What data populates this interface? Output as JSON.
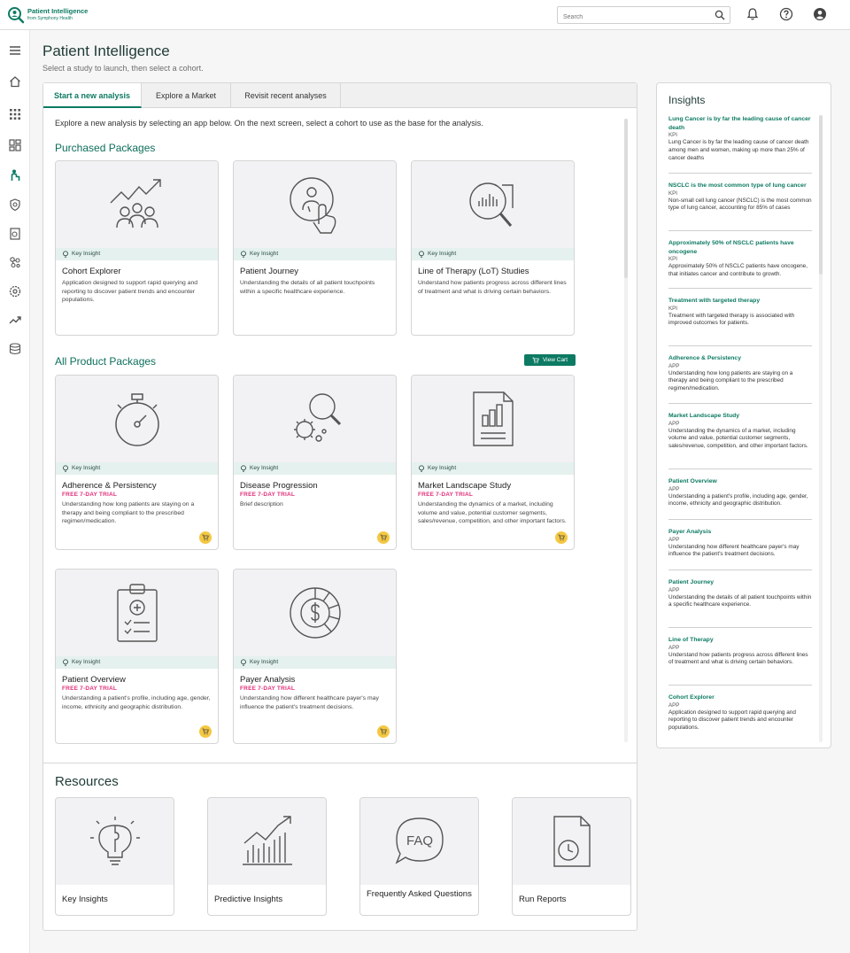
{
  "app": {
    "title": "Patient Intelligence",
    "subtitle": "from Symphony Health",
    "search_placeholder": "Search",
    "accent": "#0d7a63"
  },
  "page": {
    "title": "Patient Intelligence",
    "subtitle": "Select a study to launch, then select a cohort."
  },
  "tabs": [
    {
      "label": "Start a new analysis",
      "active": true
    },
    {
      "label": "Explore a Market",
      "active": false
    },
    {
      "label": "Revisit recent analyses",
      "active": false
    }
  ],
  "intro": "Explore a new analysis by selecting an app below. On the next screen, select a cohort to use as the base for the analysis.",
  "purchased": {
    "heading": "Purchased Packages",
    "cards": [
      {
        "title": "Cohort Explorer",
        "key_insight": "Key Insight",
        "desc": "Application designed to support rapid querying and reporting to discover patient trends and encounter populations."
      },
      {
        "title": "Patient Journey",
        "key_insight": "Key Insight",
        "desc": "Understanding the details of all patient touchpoints within a specific healthcare experience."
      },
      {
        "title": "Line of Therapy (LoT) Studies",
        "key_insight": "Key Insight",
        "desc": "Understand how patients progress across different lines of treatment and what is driving certain behaviors."
      }
    ]
  },
  "all_products": {
    "heading": "All Product Packages",
    "view_cart": "View Cart",
    "cards": [
      {
        "title": "Adherence & Persistency",
        "key_insight": "Key Insight",
        "trial": "FREE 7-DAY TRIAL",
        "desc": "Understanding how long patients are staying on a therapy and being compliant to the prescribed regimen/medication."
      },
      {
        "title": "Disease Progression",
        "key_insight": "Key Insight",
        "trial": "FREE 7-DAY TRIAL",
        "desc": "Brief description"
      },
      {
        "title": "Market Landscape Study",
        "key_insight": "Key Insight",
        "trial": "FREE 7-DAY TRIAL",
        "desc": "Understanding the dynamics of a market, including volume and value, potential customer segments, sales/revenue, competition, and other important factors."
      },
      {
        "title": "Patient Overview",
        "key_insight": "Key Insight",
        "trial": "FREE 7-DAY TRIAL",
        "desc": "Understanding a patient's profile, including age, gender, income, ethnicity and geographic distribution."
      },
      {
        "title": "Payer Analysis",
        "key_insight": "Key Insight",
        "trial": "FREE 7-DAY TRIAL",
        "desc": "Understanding how different healthcare payer's may influence the patient's treatment decisions."
      }
    ]
  },
  "resources": {
    "heading": "Resources",
    "items": [
      {
        "label": "Key Insights"
      },
      {
        "label": "Predictive Insights"
      },
      {
        "label": "Frequently Asked Questions"
      },
      {
        "label": "Run Reports"
      }
    ]
  },
  "insights": {
    "title": "Insights",
    "items": [
      {
        "heading": "Lung Cancer is by far the leading cause of cancer death",
        "type": "KPI",
        "desc": "Lung Cancer is by far the leading cause of cancer death among men and women, making up more than 25% of cancer deaths"
      },
      {
        "heading": "NSCLC is the most common type of lung cancer",
        "type": "KPI",
        "desc": "Non-small cell lung cancer (NSCLC) is the most common type of lung cancer, accounting for 85% of cases"
      },
      {
        "heading": "Approximately 50% of NSCLC patients have oncogene",
        "type": "KPI",
        "desc": "Approximately 50% of NSCLC patients have oncogene, that initiates cancer and contribute to growth."
      },
      {
        "heading": "Treatment with targeted therapy",
        "type": "KPI",
        "desc": "Treatment with targeted therapy is associated with improved outcomes for patients."
      },
      {
        "heading": "Adherence & Persistency",
        "type": "APP",
        "desc": "Understanding how long patients are staying on a therapy and being compliant to the prescribed regimen/medication."
      },
      {
        "heading": "Market Landscape Study",
        "type": "APP",
        "desc": "Understanding the dynamics of a market, including volume and value, potential customer segments, sales/revenue, competition, and other important factors."
      },
      {
        "heading": "Patient Overview",
        "type": "APP",
        "desc": "Understanding a patient's profile, including age, gender, income, ethnicity and geographic distribution."
      },
      {
        "heading": "Payer Analysis",
        "type": "APP",
        "desc": "Understanding how different healthcare payer's may influence the patient's treatment decisions."
      },
      {
        "heading": "Patient Journey",
        "type": "APP",
        "desc": "Understanding the details of all patient touchpoints within a specific healthcare experience."
      },
      {
        "heading": "Line of Therapy",
        "type": "APP",
        "desc": "Understand how patients progress across different lines of treatment and what is driving certain behaviors."
      },
      {
        "heading": "Cohort Explorer",
        "type": "APP",
        "desc": "Application designed to support rapid querying and reporting to discover patient trends and encounter populations."
      }
    ]
  }
}
